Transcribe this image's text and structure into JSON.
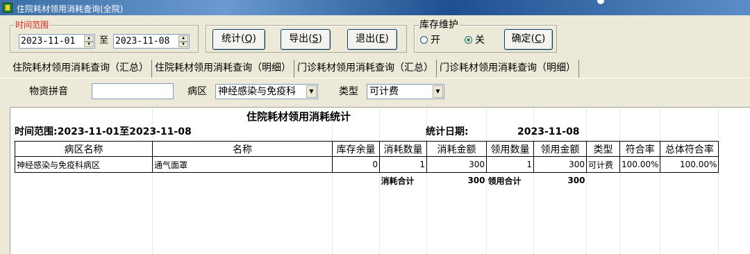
{
  "window": {
    "title": "住院耗材领用消耗查询(全院)"
  },
  "time_range": {
    "legend": "时间范围",
    "start": "2023-11-01",
    "to_label": "至",
    "end": "2023-11-08"
  },
  "buttons": {
    "stat": {
      "text": "统计(",
      "key": "Q",
      "close": ")"
    },
    "export": {
      "text": "导出(",
      "key": "S",
      "close": ")"
    },
    "exit": {
      "text": "退出(",
      "key": "E",
      "close": ")"
    },
    "confirm": {
      "text": "确定(",
      "key": "C",
      "close": ")"
    }
  },
  "inventory": {
    "legend": "库存维护",
    "on_label": "开",
    "off_label": "关",
    "selected": "关"
  },
  "tabs": [
    {
      "label": "住院耗材领用消耗查询（汇总）",
      "active": true
    },
    {
      "label": "住院耗材领用消耗查询（明细）",
      "active": false
    },
    {
      "label": "门诊耗材领用消耗查询（汇总）",
      "active": false
    },
    {
      "label": "门诊耗材领用消耗查询（明细）",
      "active": false
    }
  ],
  "filters": {
    "pinyin_label": "物资拼音",
    "pinyin_value": "",
    "ward_label": "病区",
    "ward_value": "神经感染与免疫科",
    "type_label": "类型",
    "type_value": "可计费"
  },
  "report": {
    "title": "住院耗材领用消耗统计",
    "range_text": "时间范围:2023-11-01至2023-11-08",
    "stat_date_label": "统计日期:",
    "stat_date_value": "2023-11-08",
    "columns": [
      "病区名称",
      "名称",
      "库存余量",
      "消耗数量",
      "消耗金额",
      "领用数量",
      "领用金额",
      "类型",
      "符合率",
      "总体符合率"
    ],
    "rows": [
      [
        "神经感染与免疫科病区",
        "通气面罩",
        "0",
        "1",
        "300",
        "1",
        "300",
        "可计费",
        "100.00%",
        "100.00%"
      ]
    ],
    "totals": {
      "consume_label": "消耗合计",
      "consume_value": "300",
      "use_label": "领用合计",
      "use_value": "300"
    }
  }
}
